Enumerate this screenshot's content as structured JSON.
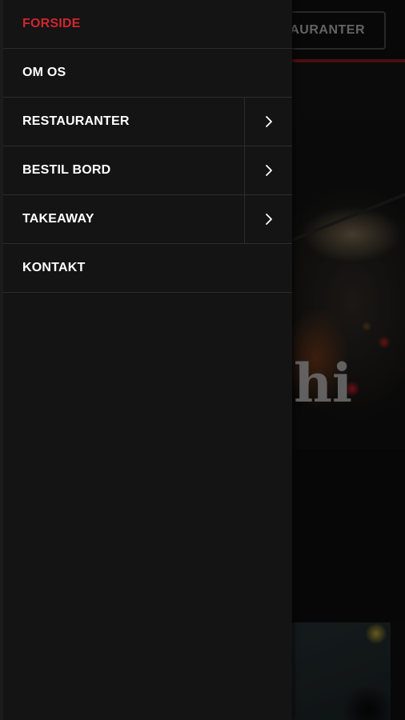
{
  "background_page": {
    "header_button_label": "TAURANTER",
    "hero_title": "shi"
  },
  "drawer": {
    "items": [
      {
        "label": "FORSIDE",
        "active": true,
        "has_submenu": false
      },
      {
        "label": "OM OS",
        "active": false,
        "has_submenu": false
      },
      {
        "label": "RESTAURANTER",
        "active": false,
        "has_submenu": true
      },
      {
        "label": "BESTIL BORD",
        "active": false,
        "has_submenu": true
      },
      {
        "label": "TAKEAWAY",
        "active": false,
        "has_submenu": true
      },
      {
        "label": "KONTAKT",
        "active": false,
        "has_submenu": false
      }
    ]
  },
  "icons": {
    "expand": "chevron-right-icon"
  },
  "colors": {
    "drawer_bg": "#141414",
    "active_item": "#d0262f",
    "item_text": "#ffffff",
    "divider": "#2c2c2c",
    "header_accent": "#6b1418"
  }
}
